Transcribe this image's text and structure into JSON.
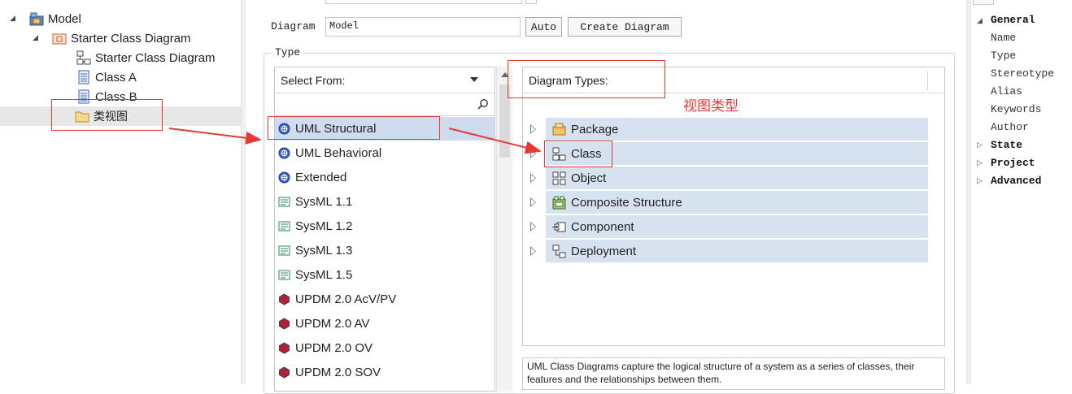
{
  "tree": {
    "items": [
      {
        "label": "Model",
        "icon": "model-package-icon"
      },
      {
        "label": "Starter Class Diagram",
        "icon": "package-icon"
      },
      {
        "label": "Starter Class Diagram",
        "icon": "class-diagram-icon"
      },
      {
        "label": "Class A",
        "icon": "class-icon"
      },
      {
        "label": "Class B",
        "icon": "class-icon"
      },
      {
        "label": "类视图",
        "icon": "folder-icon"
      }
    ]
  },
  "dialog": {
    "diagram_label": "Diagram",
    "diagram_name": "Model",
    "auto_label": "Auto",
    "create_label": "Create Diagram",
    "type_group_label": "Type",
    "select_from_label": "Select From:",
    "select_from_items": [
      {
        "label": "UML Structural",
        "icon": "uml-icon"
      },
      {
        "label": "UML Behavioral",
        "icon": "uml-icon"
      },
      {
        "label": "Extended",
        "icon": "uml-icon"
      },
      {
        "label": "SysML 1.1",
        "icon": "sysml-icon"
      },
      {
        "label": "SysML 1.2",
        "icon": "sysml-icon"
      },
      {
        "label": "SysML 1.3",
        "icon": "sysml-icon"
      },
      {
        "label": "SysML 1.5",
        "icon": "sysml-icon"
      },
      {
        "label": "UPDM 2.0 AcV/PV",
        "icon": "updm-icon"
      },
      {
        "label": "UPDM 2.0 AV",
        "icon": "updm-icon"
      },
      {
        "label": "UPDM 2.0 OV",
        "icon": "updm-icon"
      },
      {
        "label": "UPDM 2.0 SOV",
        "icon": "updm-icon"
      }
    ],
    "diagram_types_label": "Diagram Types:",
    "diagram_types": [
      {
        "label": "Package",
        "icon": "package-icon"
      },
      {
        "label": "Class",
        "icon": "class-diagram-icon"
      },
      {
        "label": "Object",
        "icon": "object-icon"
      },
      {
        "label": "Composite Structure",
        "icon": "composite-structure-icon"
      },
      {
        "label": "Component",
        "icon": "component-icon"
      },
      {
        "label": "Deployment",
        "icon": "deployment-icon"
      }
    ],
    "description": "UML Class Diagrams capture the logical structure of a system as a series of classes, their features and the relationships between them."
  },
  "annotation": {
    "text": "视图类型",
    "color": "#e53935"
  },
  "properties": {
    "general": "General",
    "fields": [
      "Name",
      "Type",
      "Stereotype",
      "Alias",
      "Keywords",
      "Author"
    ],
    "sections": [
      "State",
      "Project",
      "Advanced"
    ]
  },
  "colors": {
    "selection": "#cfdcef",
    "type_row": "#d7e2f1",
    "highlight": "#e53935"
  }
}
